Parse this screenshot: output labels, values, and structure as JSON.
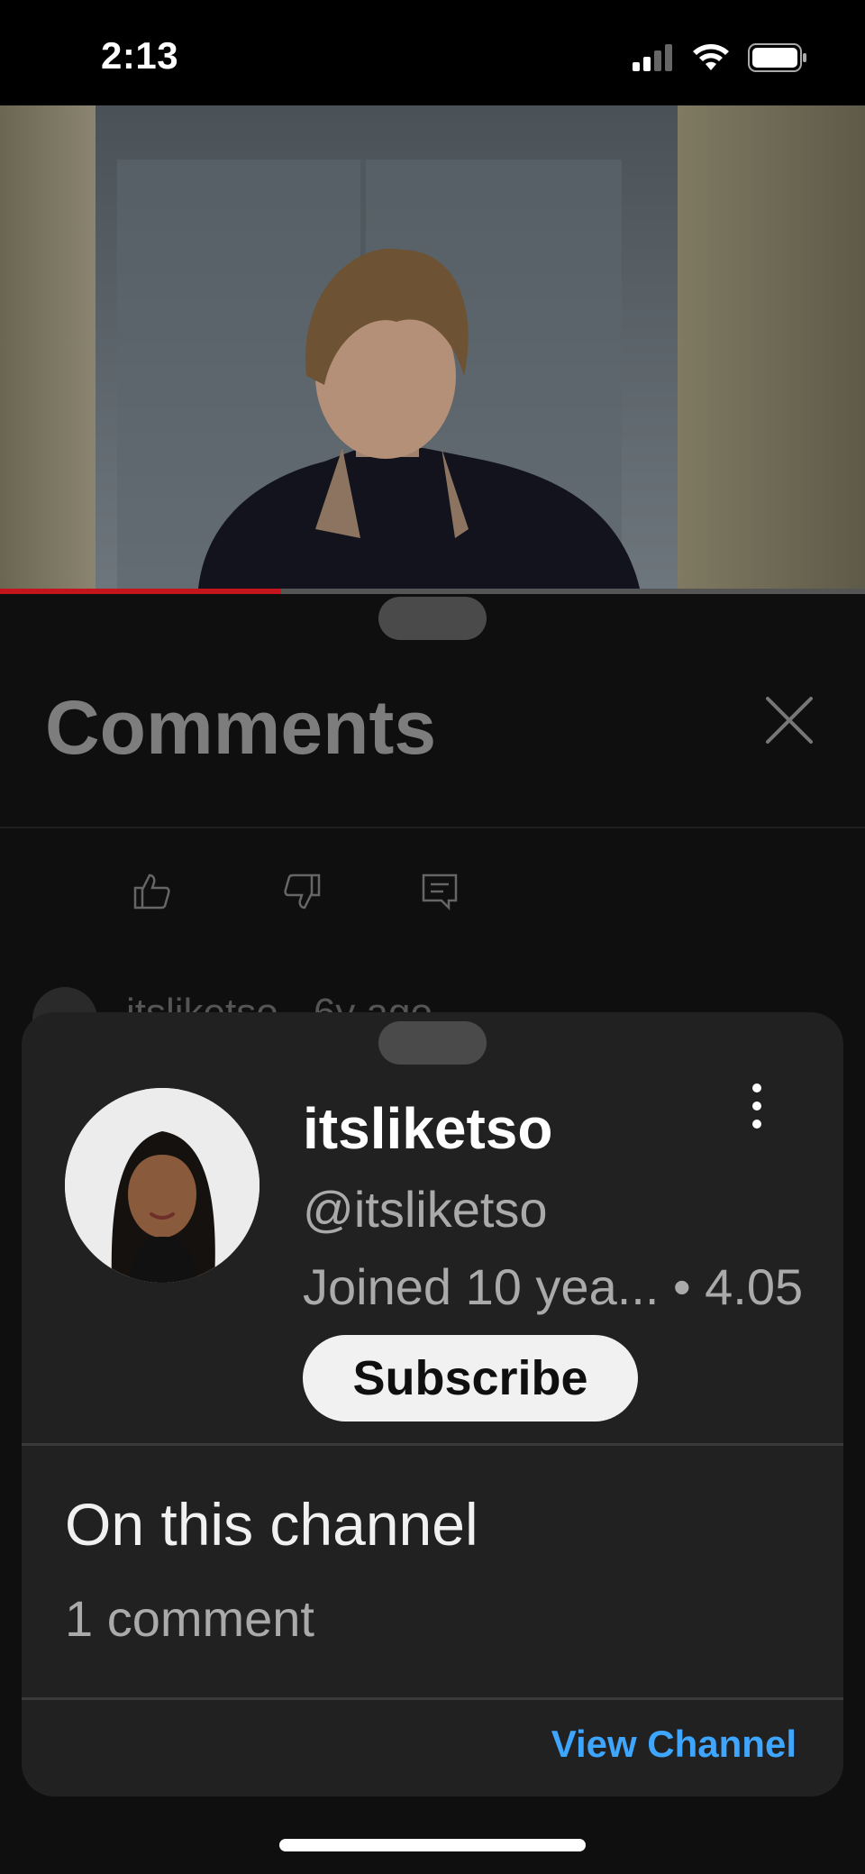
{
  "status_bar": {
    "time": "2:13",
    "icons": [
      "cellular-signal-icon",
      "wifi-icon",
      "battery-icon"
    ]
  },
  "video": {
    "progress": 0.325,
    "progress_color": "#c4151c"
  },
  "comments_panel": {
    "title": "Comments",
    "close_icon": "close-icon",
    "actions": [
      "like-icon",
      "dislike-icon",
      "reply-icon"
    ],
    "partial_comment_text": "itsliketso · 6y ago"
  },
  "channel_card": {
    "name": "itsliketso",
    "handle": "@itsliketso",
    "meta": "Joined 10 yea...  •  4.05",
    "subscribe_label": "Subscribe",
    "on_channel_heading": "On this channel",
    "comment_count": "1 comment",
    "view_channel_label": "View Channel",
    "more_icon": "more-vert-icon"
  },
  "colors": {
    "accent_link": "#3ea6ff",
    "card_bg": "#212121",
    "subscribe_bg": "#f1f1f1"
  }
}
